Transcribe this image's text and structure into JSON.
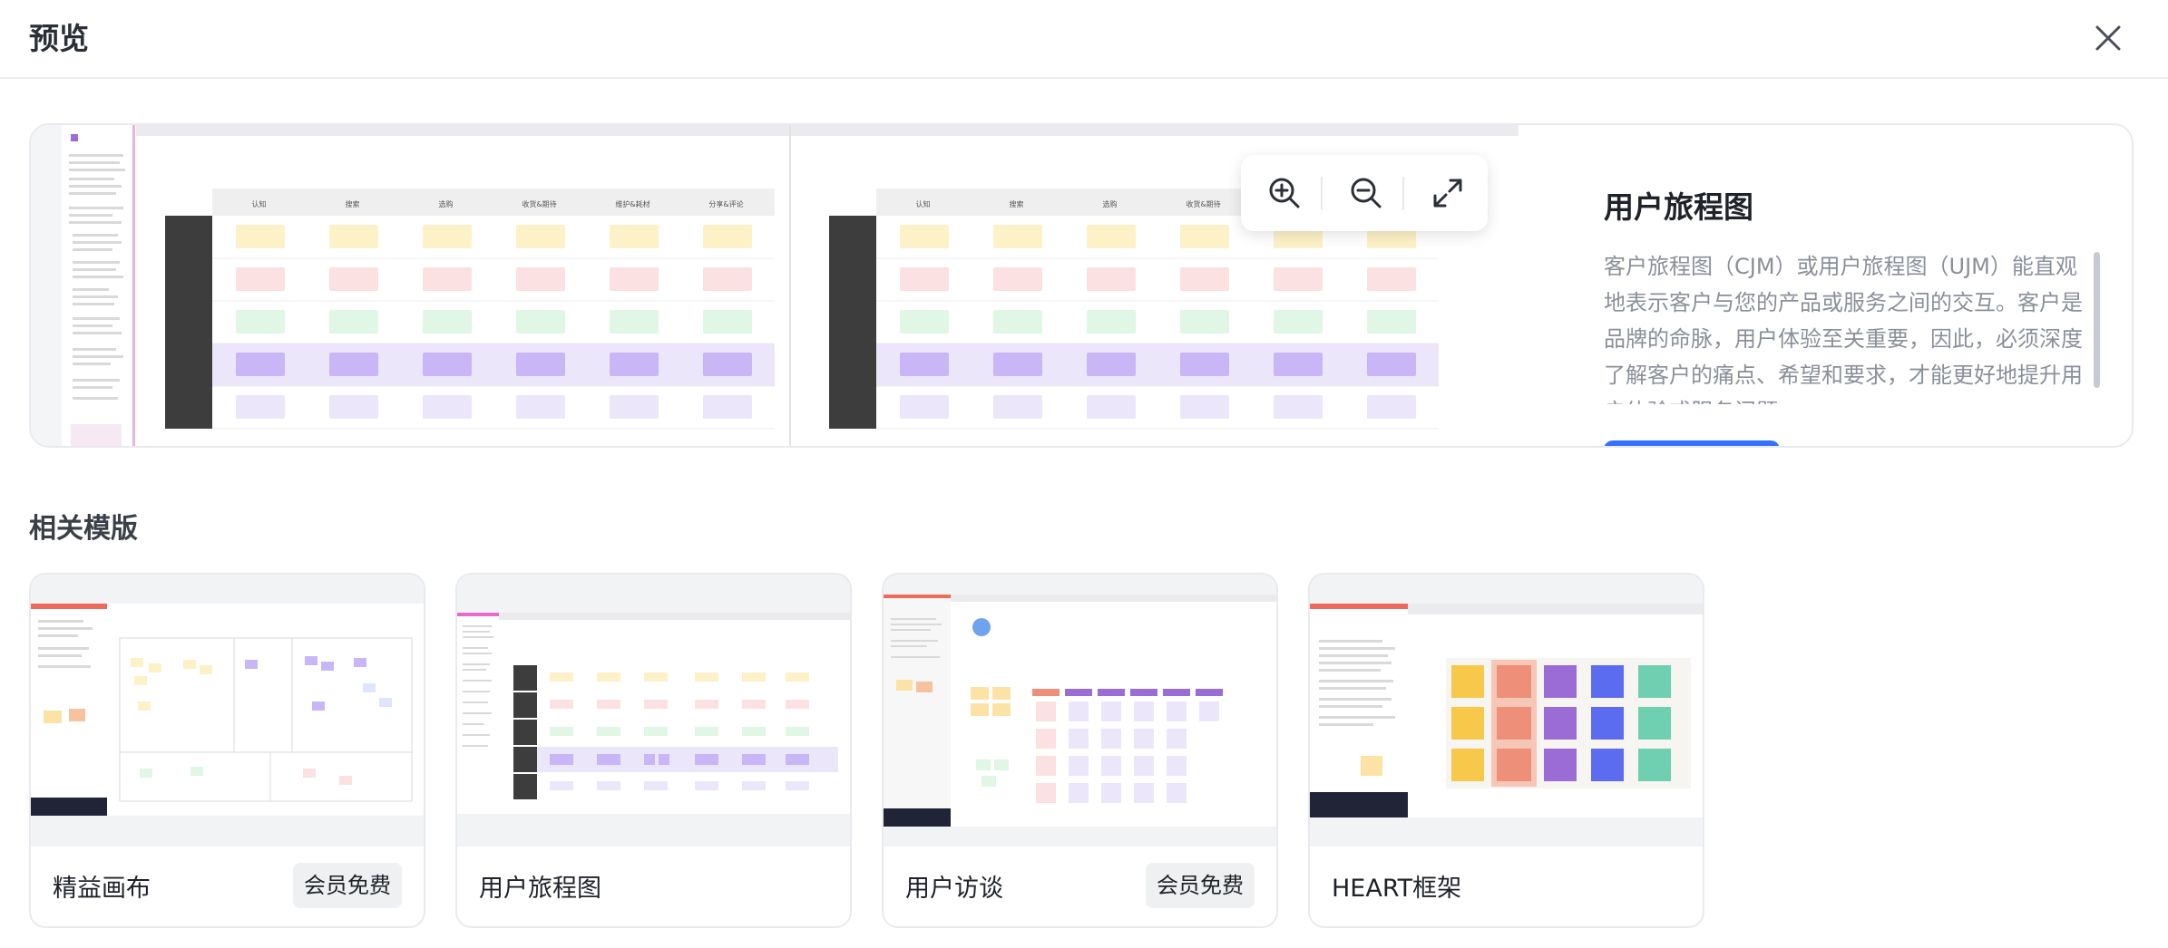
{
  "dialog": {
    "title": "预览"
  },
  "icons": {
    "close": "close-icon",
    "zoom_in": "zoom-in-icon",
    "zoom_out": "zoom-out-icon",
    "fullscreen": "expand-icon"
  },
  "preview": {
    "name": "用户旅程图",
    "description": "客户旅程图（CJM）或用户旅程图（UJM）能直观地表示客户与您的产品或服务之间的交互。客户是品牌的命脉，用户体验至关重要，因此，必须深度了解客户的痛点、希望和要求，才能更好地提升用户体验或服务问题。",
    "stages": [
      "认知",
      "搜索",
      "选购",
      "收货&期待",
      "维护&耗材",
      "分享&评论"
    ],
    "stages_right": [
      "认知",
      "搜索",
      "选购",
      "收货&期待"
    ]
  },
  "related": {
    "title": "相关模版",
    "items": [
      {
        "name": "精益画布",
        "badge": "会员免费"
      },
      {
        "name": "用户旅程图",
        "badge": ""
      },
      {
        "name": "用户访谈",
        "badge": "会员免费"
      },
      {
        "name": "HEART框架",
        "badge": ""
      }
    ]
  },
  "colors": {
    "accent": "#3370ff",
    "sticky_yellow": "#fdf1c7",
    "sticky_pink": "#fbe1e1",
    "sticky_green": "#dff7e4",
    "sticky_purple": "#c9b6f6",
    "row_dark": "#3d3d3d"
  }
}
